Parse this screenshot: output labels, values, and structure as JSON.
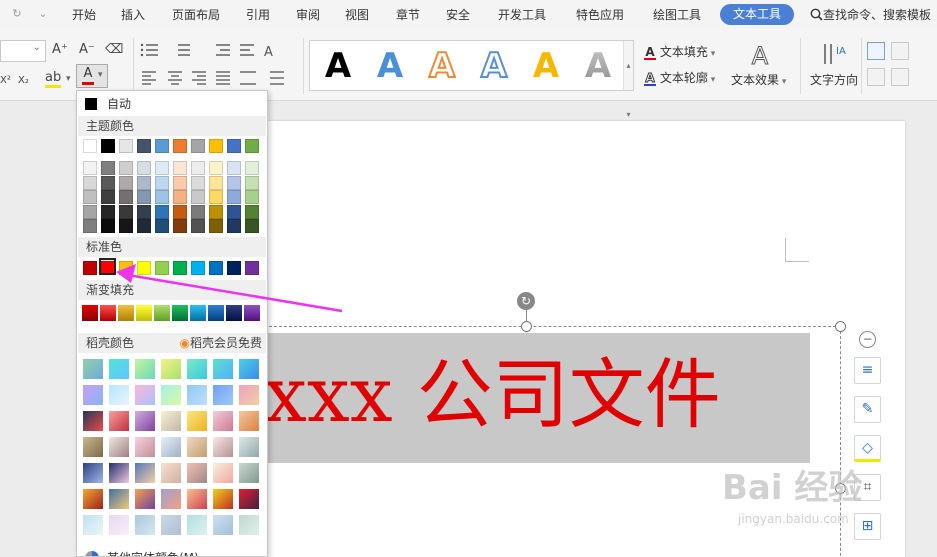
{
  "menubar": {
    "redo_glyph": "↻",
    "more_glyph": "⌄",
    "items": [
      "开始",
      "插入",
      "页面布局",
      "引用",
      "审阅",
      "视图",
      "章节",
      "安全",
      "开发工具",
      "特色应用",
      "绘图工具"
    ],
    "active_tab": "文本工具",
    "search": "查找命令、搜索模板"
  },
  "ribbon": {
    "grow_font": "A⁺",
    "shrink_font": "A⁻",
    "clear_format": "⌫",
    "superscript": "X²",
    "subscript": "X₂",
    "highlight": "ab",
    "font_color_glyph": "A",
    "text_fill": "文本填充",
    "text_outline": "文本轮廓",
    "text_effect": "文本效果",
    "text_direction": "文字方向",
    "gallery_letter": "A",
    "gallery_styles": [
      {
        "color": "#000000",
        "style": "solid"
      },
      {
        "color": "#4a8fd8",
        "style": "solid"
      },
      {
        "color": "#ee8a3c",
        "style": "outline"
      },
      {
        "color": "#5a8fd8",
        "style": "outline"
      },
      {
        "color": "#f5b800",
        "style": "solid"
      },
      {
        "color": "#8c8c8c",
        "style": "gradient"
      }
    ]
  },
  "dropdown": {
    "auto": "自动",
    "theme_colors": "主题颜色",
    "standard_colors": "标准色",
    "gradient_fill": "渐变填充",
    "docer_colors": "稻壳颜色",
    "member_free": "稻壳会员免费",
    "more_colors": "其他字体颜色(M)...",
    "theme_base": [
      "#ffffff",
      "#000000",
      "#e7e6e6",
      "#44546a",
      "#5b9bd5",
      "#ed7d31",
      "#a5a5a5",
      "#ffc000",
      "#4472c4",
      "#70ad47"
    ],
    "theme_shades": [
      [
        "#f2f2f2",
        "#7f7f7f",
        "#d0cece",
        "#d6dce4",
        "#deebf6",
        "#fbe5d5",
        "#ededed",
        "#fff2cc",
        "#d9e2f3",
        "#e2efd9"
      ],
      [
        "#d8d8d8",
        "#595959",
        "#aeaaaa",
        "#adb9ca",
        "#bdd7ee",
        "#f7cbac",
        "#dbdbdb",
        "#fee599",
        "#b4c6e7",
        "#c5e0b3"
      ],
      [
        "#bfbfbf",
        "#3f3f3f",
        "#757070",
        "#8496b0",
        "#9dc3e6",
        "#f4b183",
        "#c9c9c9",
        "#ffd965",
        "#8eaadb",
        "#a8d08d"
      ],
      [
        "#a5a5a5",
        "#262626",
        "#3a3838",
        "#323f4f",
        "#2e75b5",
        "#c55a11",
        "#7b7b7b",
        "#bf9000",
        "#2f5496",
        "#538135"
      ],
      [
        "#7f7f7f",
        "#0c0c0c",
        "#171616",
        "#222a35",
        "#1e4e79",
        "#833c0b",
        "#525252",
        "#7f6000",
        "#1f3864",
        "#375623"
      ]
    ],
    "standard": [
      "#c00000",
      "#ff0000",
      "#ffc000",
      "#ffff00",
      "#92d050",
      "#00b050",
      "#00b0f0",
      "#0070c0",
      "#002060",
      "#7030a0"
    ],
    "selected_standard": "#ff0000",
    "gradients": [
      [
        "#e00000",
        "#8a0000"
      ],
      [
        "#ff5050",
        "#b00000"
      ],
      [
        "#f0c040",
        "#b08000"
      ],
      [
        "#ffff40",
        "#c0c000"
      ],
      [
        "#b0e070",
        "#60a020"
      ],
      [
        "#20c060",
        "#007030"
      ],
      [
        "#30c0f0",
        "#0070a0"
      ],
      [
        "#3080d0",
        "#004080"
      ],
      [
        "#304080",
        "#001040"
      ],
      [
        "#9050c0",
        "#501080"
      ]
    ],
    "docer_rows": [
      [
        [
          "#8fd3a8",
          "#6fa8dc"
        ],
        [
          "#53e3d4",
          "#5fc6ff"
        ],
        [
          "#c4f5a0",
          "#6ad8b8"
        ],
        [
          "#f7f08a",
          "#a3e36a"
        ],
        [
          "#7ee8c6",
          "#38c9e0"
        ],
        [
          "#5fe0c8",
          "#4fb0ff"
        ],
        [
          "#4fd0e0",
          "#3a8cf0"
        ]
      ],
      [
        [
          "#c7a0f0",
          "#88b4f6"
        ],
        [
          "#b7e5ff",
          "#e8f4ff"
        ],
        [
          "#ffb5d6",
          "#a7c3ff"
        ],
        [
          "#a8f0e0",
          "#d8f8a8"
        ],
        [
          "#90c8f0",
          "#c0e0ff"
        ],
        [
          "#70a0f0",
          "#a0c8ff"
        ],
        [
          "#f0a0c0",
          "#f0d0a0"
        ]
      ],
      [
        [
          "#203858",
          "#f04848"
        ],
        [
          "#f8a0a0",
          "#c03040"
        ],
        [
          "#d0b0e0",
          "#8040a0"
        ],
        [
          "#f8f0d0",
          "#c0b8a8"
        ],
        [
          "#f8e880",
          "#f0b020"
        ],
        [
          "#f0d0d8",
          "#d07890"
        ],
        [
          "#f0c8a0",
          "#e08040"
        ]
      ],
      [
        [
          "#c8b890",
          "#806848"
        ],
        [
          "#f0e8e0",
          "#a08080"
        ],
        [
          "#f8d0e0",
          "#c09098"
        ],
        [
          "#e8f0f8",
          "#a0b0c8"
        ],
        [
          "#f0d8c0",
          "#c0a070"
        ],
        [
          "#f8e8e8",
          "#b89090"
        ],
        [
          "#e0e8e8",
          "#90a8a8"
        ]
      ],
      [
        [
          "#304080",
          "#a0b8e8"
        ],
        [
          "#203070",
          "#f0c8d8"
        ],
        [
          "#5878b8",
          "#f0d0a8"
        ],
        [
          "#f8e0d0",
          "#d0b0a0"
        ],
        [
          "#f0c0b0",
          "#a08888"
        ],
        [
          "#f8f0e0",
          "#f0a8a0"
        ],
        [
          "#c8d8d0",
          "#809890"
        ]
      ],
      [
        [
          "#f0a830",
          "#a02020"
        ],
        [
          "#4070a8",
          "#f0c878"
        ],
        [
          "#f8a050",
          "#7040a0"
        ],
        [
          "#a0a0d0",
          "#f0a080"
        ],
        [
          "#f8c090",
          "#d04050"
        ],
        [
          "#f0d020",
          "#c03020"
        ],
        [
          "#e02030",
          "#402040"
        ]
      ],
      [
        [
          "#c0e0f0",
          "#e8f8f8"
        ],
        [
          "#e8d8f0",
          "#f8f0f8"
        ],
        [
          "#a8c8d8",
          "#d8e8f0"
        ],
        [
          "#c8d8e8",
          "#b0c0d0"
        ],
        [
          "#b0e0e0",
          "#e0f0f0"
        ],
        [
          "#d0e0f0",
          "#a0c0d8"
        ],
        [
          "#c0d8d0",
          "#e0f0e8"
        ]
      ]
    ]
  },
  "document": {
    "text": "xxx 公司文件",
    "text_color": "#e00000",
    "highlight_color": "#c8c8c8"
  },
  "side_toolbar": {
    "collapse": "−",
    "icons": [
      "wrap-text-icon",
      "pen-icon",
      "fill-icon",
      "crop-icon",
      "layout-icon"
    ]
  },
  "watermark": {
    "brand": "Bai 经验",
    "url": "jingyan.baidu.com"
  },
  "annotation": {
    "color": "#ee33ee"
  }
}
